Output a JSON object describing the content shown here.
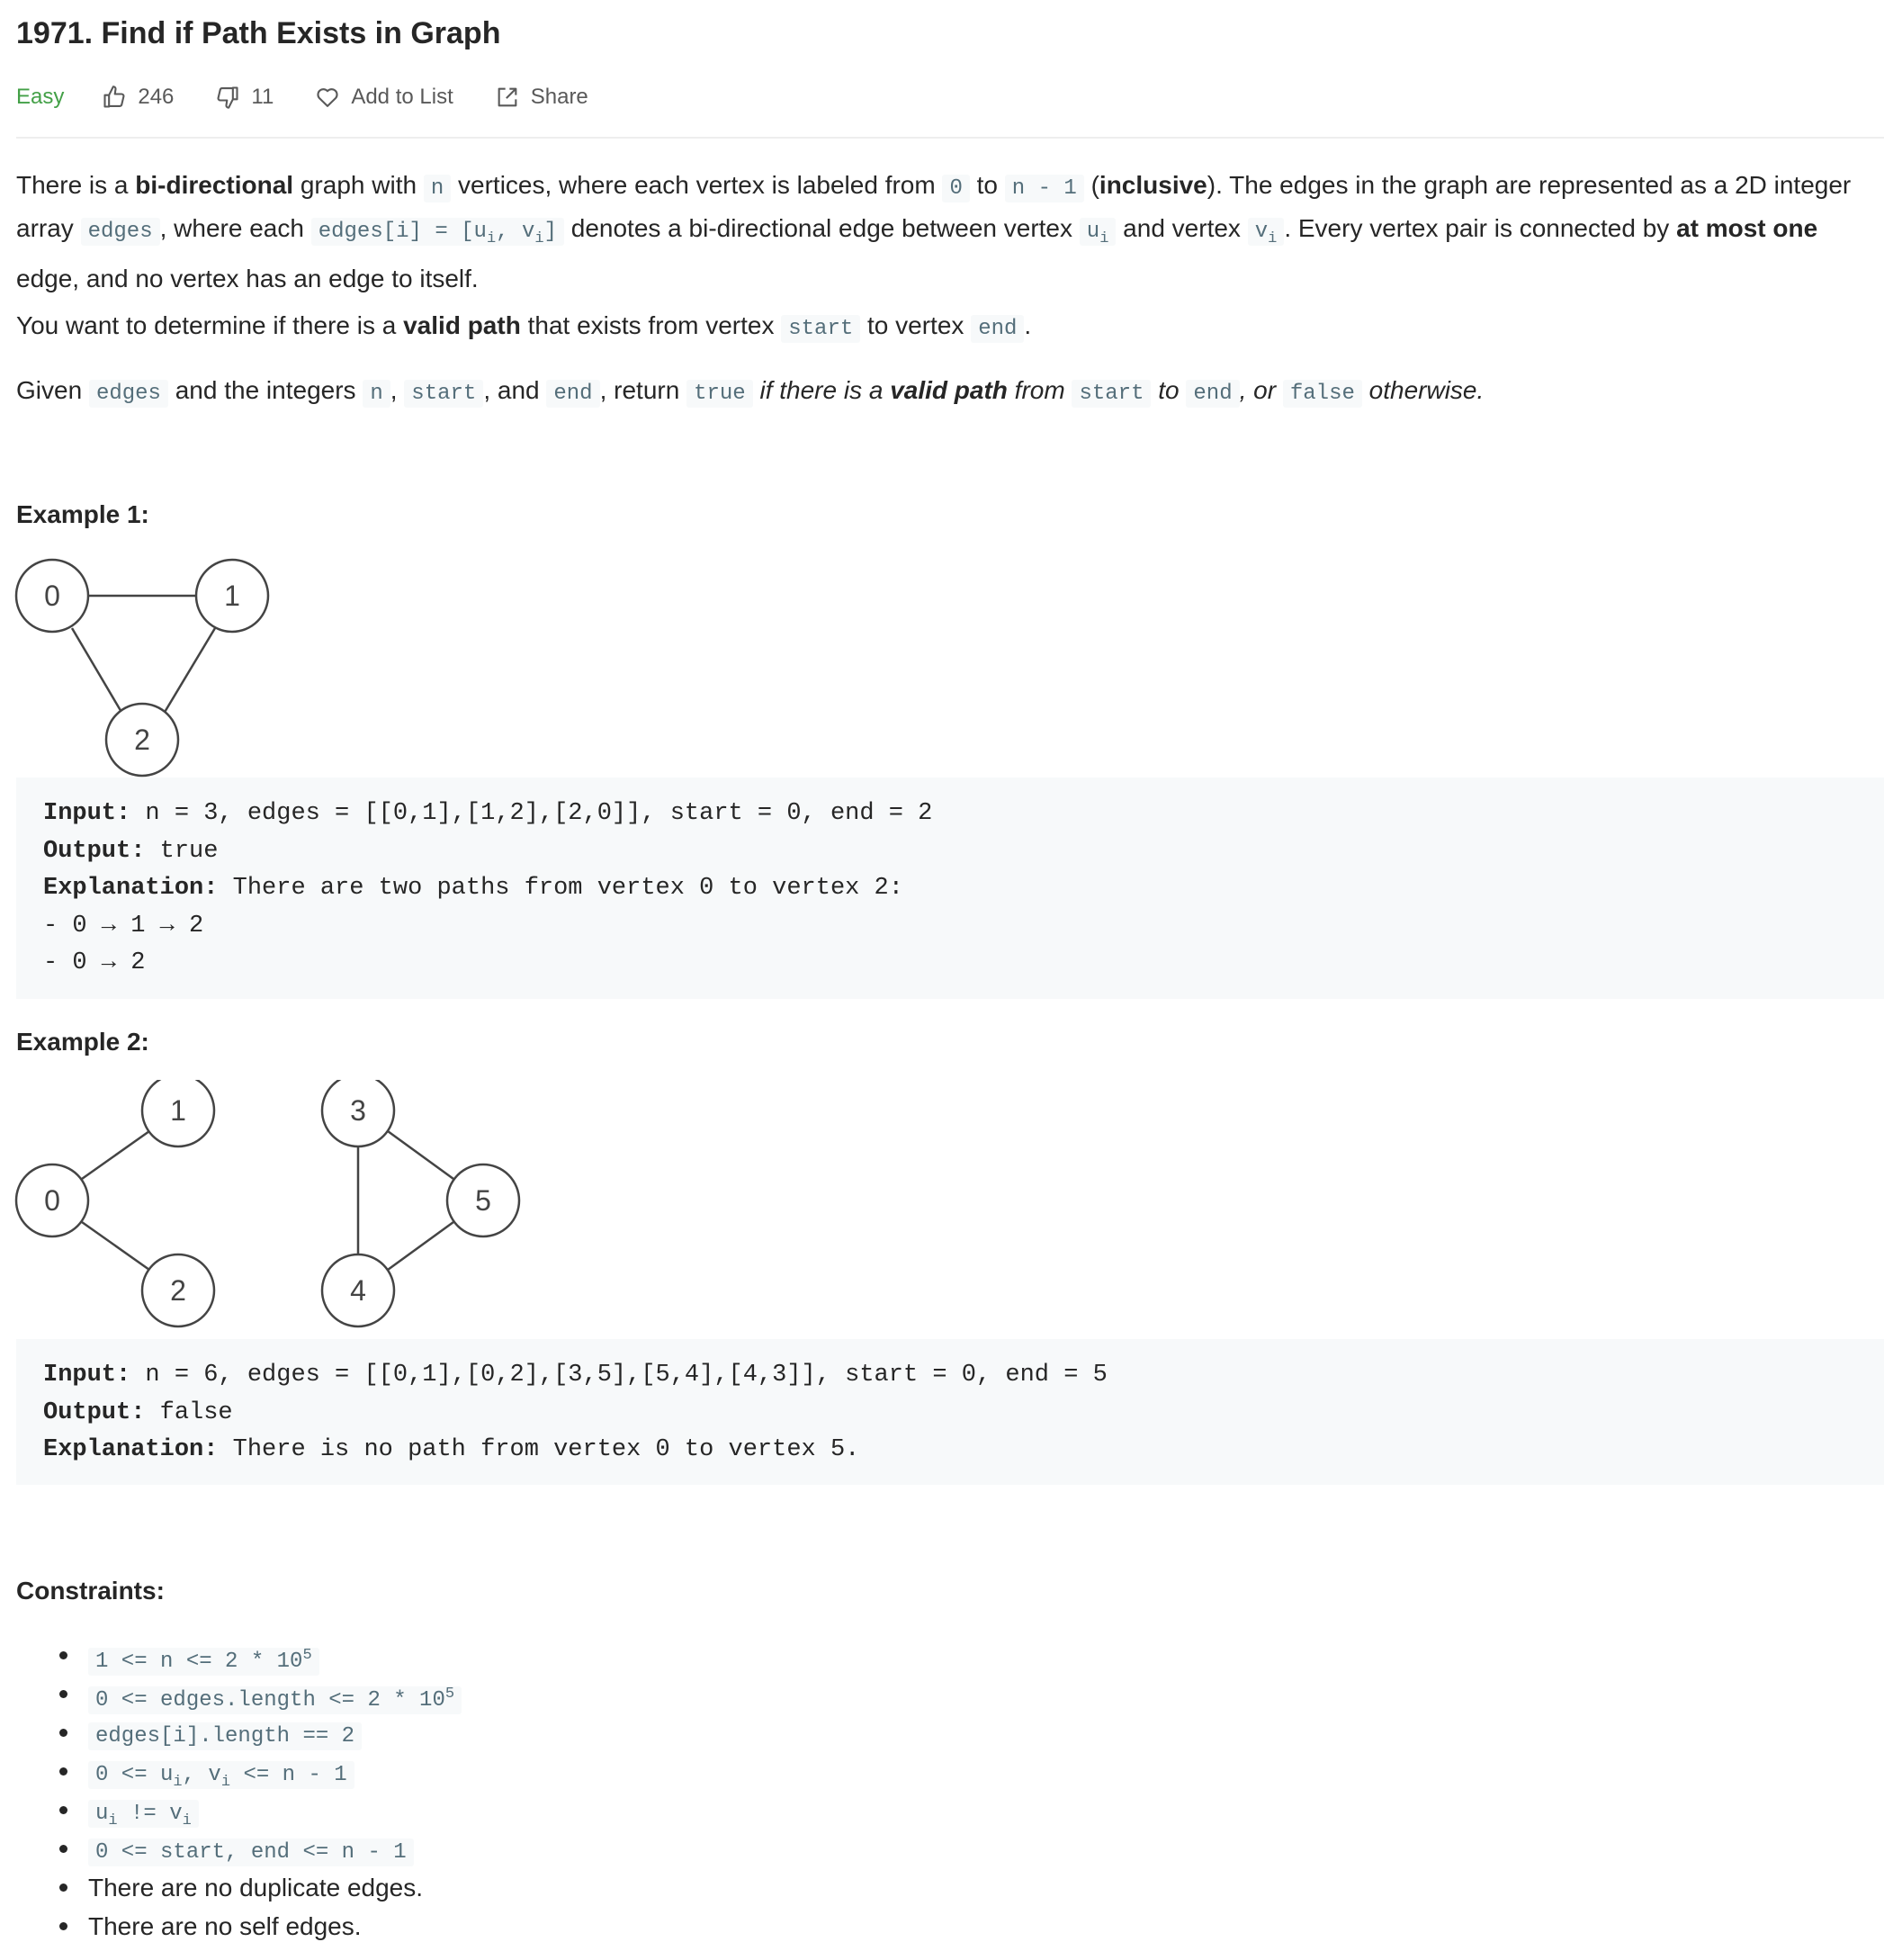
{
  "problem": {
    "title": "1971. Find if Path Exists in Graph",
    "difficulty": "Easy",
    "likes": "246",
    "dislikes": "11",
    "add_to_list": "Add to List",
    "share": "Share"
  },
  "description": {
    "p1": {
      "t1": "There is a ",
      "b1": "bi-directional",
      "t2": " graph with ",
      "c1": "n",
      "t3": " vertices, where each vertex is labeled from ",
      "c2": "0",
      "t4": " to ",
      "c3": "n - 1",
      "t5": " (",
      "b2": "inclusive",
      "t6": "). The edges in the graph are represented as a 2D integer array ",
      "c4": "edges",
      "t7": ", where each ",
      "c5a": "edges[i] = [u",
      "c5sub1": "i",
      "c5b": ", v",
      "c5sub2": "i",
      "c5c": "]",
      "t8": " denotes a bi-directional edge between vertex ",
      "c6a": "u",
      "c6sub": "i",
      "t9": " and vertex ",
      "c7a": "v",
      "c7sub": "i",
      "t10": ". Every vertex pair is connected by ",
      "b3": "at most one",
      "t11": " edge, and no vertex has an edge to itself."
    },
    "p2": {
      "t1": "You want to determine if there is a ",
      "b1": "valid path",
      "t2": " that exists from vertex ",
      "c1": "start",
      "t3": " to vertex ",
      "c2": "end",
      "t4": "."
    },
    "p3": {
      "t1": "Given ",
      "c1": "edges",
      "t2": " and the integers ",
      "c2": "n",
      "t3": ", ",
      "c3": "start",
      "t4": ", and ",
      "c4": "end",
      "t5": ", return ",
      "c5": "true",
      "i1": " if there is a ",
      "b1": "valid path",
      "i2": " from ",
      "c6": "start",
      "i3": " to ",
      "c7": "end",
      "i4": ", or ",
      "c8": "false",
      "i5": " otherwise."
    }
  },
  "examples": [
    {
      "heading": "Example 1:",
      "nodes": [
        "0",
        "1",
        "2"
      ],
      "input_label": "Input:",
      "input": " n = 3, edges = [[0,1],[1,2],[2,0]], start = 0, end = 2",
      "output_label": "Output:",
      "output": " true",
      "explanation_label": "Explanation:",
      "explanation": " There are two paths from vertex 0 to vertex 2:",
      "extra_lines": [
        "- 0 → 1 → 2",
        "- 0 → 2"
      ]
    },
    {
      "heading": "Example 2:",
      "nodes": [
        "0",
        "1",
        "2",
        "3",
        "4",
        "5"
      ],
      "input_label": "Input:",
      "input": " n = 6, edges = [[0,1],[0,2],[3,5],[5,4],[4,3]], start = 0, end = 5",
      "output_label": "Output:",
      "output": " false",
      "explanation_label": "Explanation:",
      "explanation": " There is no path from vertex 0 to vertex 5."
    }
  ],
  "constraints": {
    "heading": "Constraints:",
    "c1a": "1 <= n <= 2 * 10",
    "c1sup": "5",
    "c2a": "0 <= edges.length <= 2 * 10",
    "c2sup": "5",
    "c3": "edges[i].length == 2",
    "c4a": "0 <= u",
    "c4sub1": "i",
    "c4b": ", v",
    "c4sub2": "i",
    "c4c": " <= n - 1",
    "c5a": "u",
    "c5sub1": "i",
    "c5b": " != v",
    "c5sub2": "i",
    "c6": "0 <= start, end <= n - 1",
    "c7": "There are no duplicate edges.",
    "c8": "There are no self edges."
  }
}
